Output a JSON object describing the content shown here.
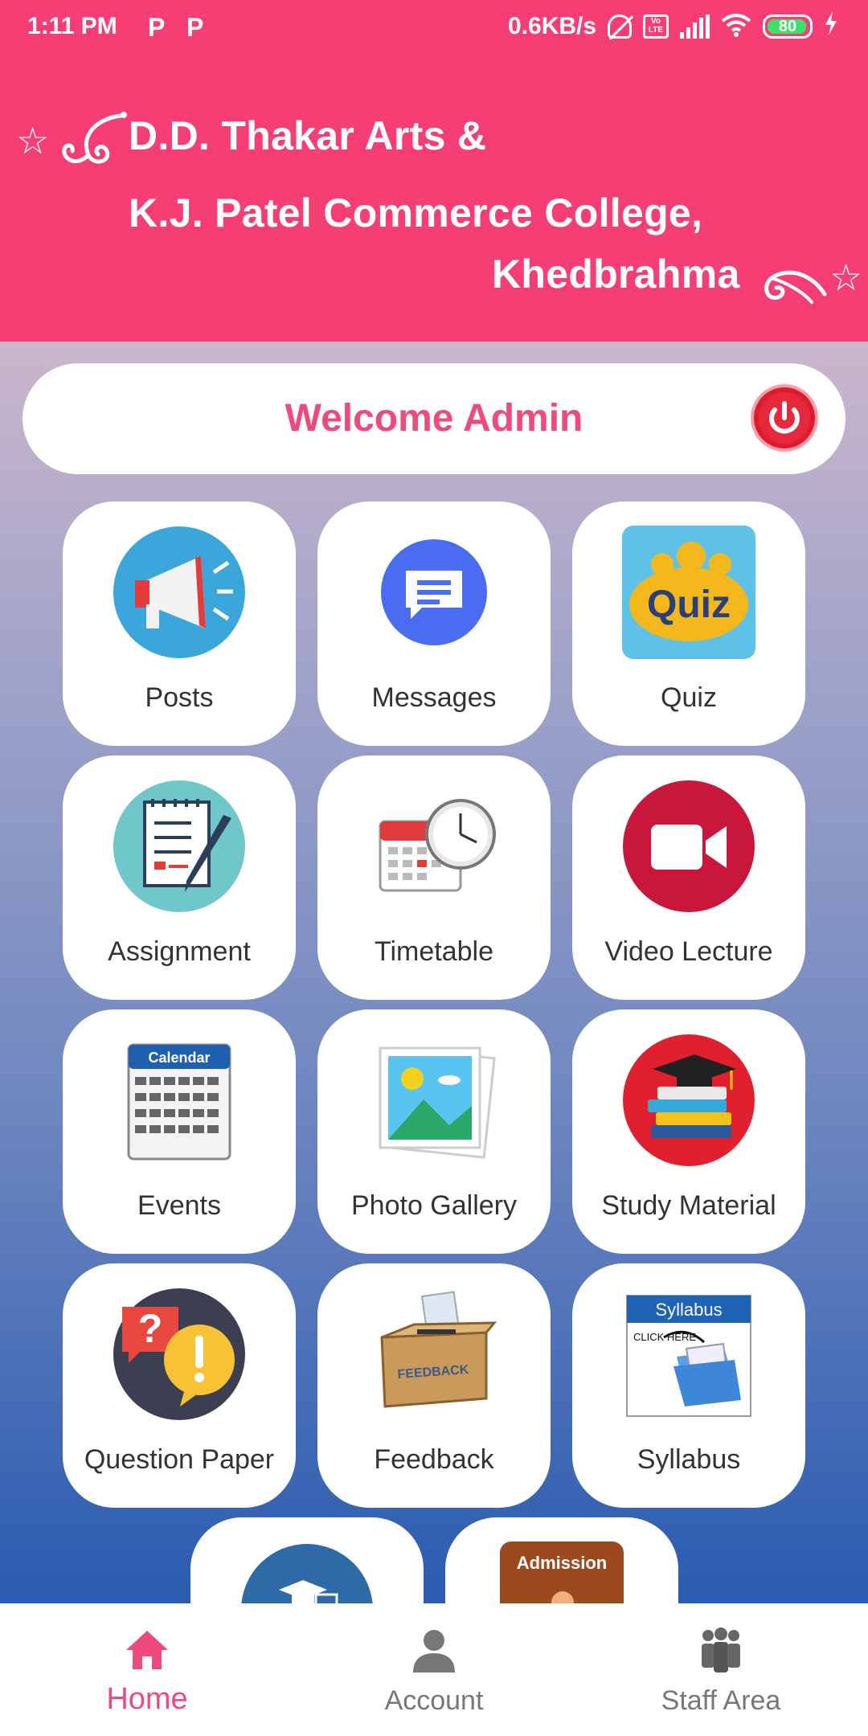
{
  "status_bar": {
    "time": "1:11 PM",
    "app_indicators": [
      "P",
      "P"
    ],
    "net_speed": "0.6KB/s",
    "volte_label": "Vo LTE",
    "battery": "80"
  },
  "header": {
    "title_line1": "D.D. Thakar Arts &",
    "title_line2": "K.J. Patel Commerce College,",
    "title_line3": "Khedbrahma",
    "star_glyph": "☆"
  },
  "welcome": {
    "text": "Welcome  Admin"
  },
  "tiles": [
    {
      "label": "Posts",
      "icon": "megaphone-icon"
    },
    {
      "label": "Messages",
      "icon": "chat-icon"
    },
    {
      "label": "Quiz",
      "icon": "quiz-icon",
      "icon_text": "Quiz"
    },
    {
      "label": "Assignment",
      "icon": "assignment-icon"
    },
    {
      "label": "Timetable",
      "icon": "calendar-clock-icon"
    },
    {
      "label": "Video Lecture",
      "icon": "video-camera-icon"
    },
    {
      "label": "Events",
      "icon": "calendar-icon",
      "icon_text": "Calendar"
    },
    {
      "label": "Photo Gallery",
      "icon": "gallery-icon"
    },
    {
      "label": "Study Material",
      "icon": "books-icon"
    },
    {
      "label": "Question Paper",
      "icon": "question-icon",
      "icon_text": "?"
    },
    {
      "label": "Feedback",
      "icon": "feedback-box-icon",
      "icon_text": "FEEDBACK"
    },
    {
      "label": "Syllabus",
      "icon": "syllabus-icon",
      "icon_text": "Syllabus",
      "icon_subtext": "CLICK HERE"
    }
  ],
  "partial_tiles": [
    {
      "icon": "graduation-icon"
    },
    {
      "icon": "admission-icon",
      "icon_text": "Admission"
    }
  ],
  "nav": {
    "items": [
      {
        "label": "Home",
        "icon": "home-icon",
        "active": true
      },
      {
        "label": "Account",
        "icon": "person-icon",
        "active": false
      },
      {
        "label": "Staff Area",
        "icon": "staff-icon",
        "active": false
      }
    ]
  },
  "colors": {
    "header": "#f53f74",
    "accent": "#ef4a7c",
    "power": "#e01a2f"
  }
}
